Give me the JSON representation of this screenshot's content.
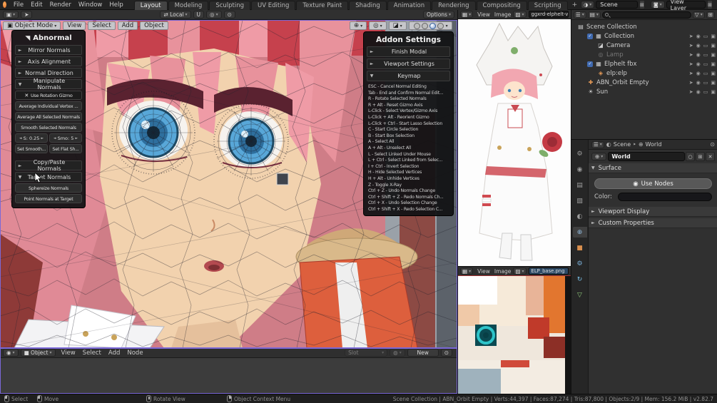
{
  "topbar": {
    "menus": [
      "File",
      "Edit",
      "Render",
      "Window",
      "Help"
    ],
    "tabs": [
      {
        "label": "Layout",
        "state": "active"
      },
      {
        "label": "Modeling"
      },
      {
        "label": "Sculpting"
      },
      {
        "label": "UV Editing"
      },
      {
        "label": "Texture Paint"
      },
      {
        "label": "Shading"
      },
      {
        "label": "Animation"
      },
      {
        "label": "Rendering"
      },
      {
        "label": "Compositing"
      },
      {
        "label": "Scripting"
      }
    ],
    "new_workspace": "+",
    "scene_selector": "Scene",
    "view_layer_selector": "View Layer"
  },
  "tool_settings": {
    "orientation": "Local",
    "options_label": "Options"
  },
  "viewport": {
    "mode": "Object Mode",
    "menus": [
      "View",
      "Select",
      "Add",
      "Object"
    ]
  },
  "abnormal": {
    "title": "Abnormal",
    "mirror_normals": "Mirror Normals",
    "axis_alignment": "Axis Alignment",
    "normal_direction": "Normal Direction",
    "manipulate_normals": "Manipulate Normals",
    "use_rotation_gizmo": "Use Rotation Gizmo",
    "buttons": [
      "Average Individual Vertex ...",
      "Average All Selected Normals",
      "Smooth Selected Normals"
    ],
    "stepper_s": "S: 0.25",
    "stepper_smo": "Smo: 5",
    "set_smooth": "Set Smooth...",
    "set_flat": "Set Flat Sh...",
    "copy_paste": "Copy/Paste Normals",
    "target_normals": "Target Normals",
    "target_buttons": [
      "Sphereize Normals",
      "Point Normals at Target"
    ]
  },
  "addon": {
    "title": "Addon Settings",
    "finish_modal": "Finish Modal",
    "viewport_settings": "Viewport Settings",
    "keymap": "Keymap",
    "keymap_lines": [
      "ESC - Cancel Normal Editing",
      "Tab - End and Confirm Normal Edit...",
      "R - Rotate Selected Normals",
      "R + Alt - Reset Gizmo Axis",
      "L-Click - Select Vertex/Gizmo Axis",
      "L-Click + Alt - Reorient Gizmo",
      "L-Click + Ctrl - Start Lasso Selection",
      "C - Start Circle Selection",
      "B - Start Box Selection",
      "A - Select All",
      "A + Alt - Unselect All",
      "L - Select Linked Under Mouse",
      "L + Ctrl - Select Linked from Selec...",
      "I + Ctrl - Invert Selection",
      "H - Hide Selected Vertices",
      "H + Alt - Unhide Vertices",
      "Z - Toggle X-Ray",
      "Ctrl + Z - Undo Normals Change",
      "Ctrl + Shift + Z - Redo Normals Ch...",
      "Ctrl + X - Undo Selection Change",
      "Ctrl + Shift + X - Redo Selection C..."
    ]
  },
  "image_editor_top": {
    "menus": [
      "View",
      "Image"
    ],
    "image_name": "ggxrd-elphelt-val"
  },
  "image_editor_bottom": {
    "menus": [
      "View",
      "Image"
    ],
    "image_name": "ELP_base.png"
  },
  "shader_editor": {
    "type": "Object",
    "menus": [
      "View",
      "Select",
      "Add",
      "Node"
    ],
    "slot": "Slot",
    "new_label": "New"
  },
  "outliner": {
    "rows": [
      {
        "label": "Scene Collection",
        "icon": "scene-collection-icon",
        "depth": "d0"
      },
      {
        "label": "Collection",
        "icon": "collection-icon",
        "depth": "d1",
        "checkbox": "on",
        "toggles": "show"
      },
      {
        "label": "Camera",
        "icon": "camera-icon",
        "depth": "d2",
        "toggles": "show"
      },
      {
        "label": "Lamp",
        "icon": "light-icon",
        "depth": "d2",
        "cls": "dim",
        "toggles": "show"
      },
      {
        "label": "Elphelt fbx",
        "icon": "fbx-icon",
        "depth": "d1",
        "checkbox": "on",
        "toggles": "show"
      },
      {
        "label": "elp:elp",
        "icon": "armature-icon",
        "depth": "d2",
        "toggles": "show"
      },
      {
        "label": "ABN_Orbit Empty",
        "icon": "empty-icon",
        "depth": "d1",
        "toggles": "show"
      },
      {
        "label": "Sun",
        "icon": "sun-icon",
        "depth": "d1",
        "toggles": "show"
      }
    ]
  },
  "properties": {
    "tabs": [
      {
        "icon": "tab-tool"
      },
      {
        "icon": "tab-render"
      },
      {
        "icon": "tab-output"
      },
      {
        "icon": "tab-view-layer"
      },
      {
        "icon": "tab-scene"
      },
      {
        "icon": "tab-world",
        "state": "active"
      },
      {
        "icon": "tab-object"
      },
      {
        "icon": "tab-modifiers"
      },
      {
        "icon": "tab-physics"
      },
      {
        "icon": "tab-object-data"
      }
    ],
    "breadcrumb_scene": "Scene",
    "breadcrumb_world": "World",
    "world_name": "World",
    "surface_label": "Surface",
    "use_nodes": "Use Nodes",
    "color_label": "Color:",
    "viewport_display": "Viewport Display",
    "custom_properties": "Custom Properties"
  },
  "statusbar": {
    "hints": [
      {
        "icon": "mouse-left-icon",
        "label": "Select"
      },
      {
        "icon": "mouse-left-icon",
        "label": "Move"
      },
      {
        "icon": "mouse-middle-icon",
        "label": "Rotate View"
      },
      {
        "icon": "mouse-right-icon",
        "label": "Object Context Menu"
      }
    ],
    "stats": "Scene Collection | ABN_Orbit Empty | Verts:44,397 | Faces:87,274 | Tris:87,800 | Objects:2/9 | Mem: 156.2 MiB | v2.82.7"
  },
  "colors": {
    "viewport_border": "#7a68d8",
    "hair_pink": "#e8929c",
    "face_skin": "#f2d2ae",
    "eye_blue": "#58a7d8",
    "armor_orange": "#dd5f3d",
    "teal_ring": "#2ec4c9",
    "accent_blue": "#406ab0"
  }
}
